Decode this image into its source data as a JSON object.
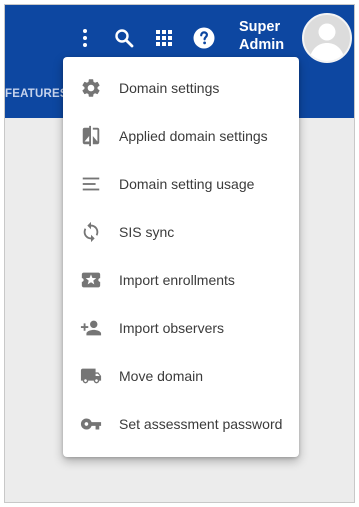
{
  "header": {
    "features_label": "FEATURES",
    "user_name_line1": "Super",
    "user_name_line2": "Admin",
    "icons": [
      "more-vert-icon",
      "search-icon",
      "apps-grid-icon",
      "help-icon",
      "avatar"
    ],
    "colors": {
      "bar": "#0d47a1",
      "icon": "#ffffff"
    }
  },
  "menu": {
    "items": [
      {
        "label": "Domain settings",
        "icon": "gear-icon"
      },
      {
        "label": "Applied domain settings",
        "icon": "compare-icon"
      },
      {
        "label": "Domain setting usage",
        "icon": "lines-icon"
      },
      {
        "label": "SIS sync",
        "icon": "sync-icon"
      },
      {
        "label": "Import enrollments",
        "icon": "ticket-star-icon"
      },
      {
        "label": "Import observers",
        "icon": "person-add-icon"
      },
      {
        "label": "Move domain",
        "icon": "truck-icon"
      },
      {
        "label": "Set assessment password",
        "icon": "key-icon"
      }
    ],
    "icon_color": "#757575"
  }
}
